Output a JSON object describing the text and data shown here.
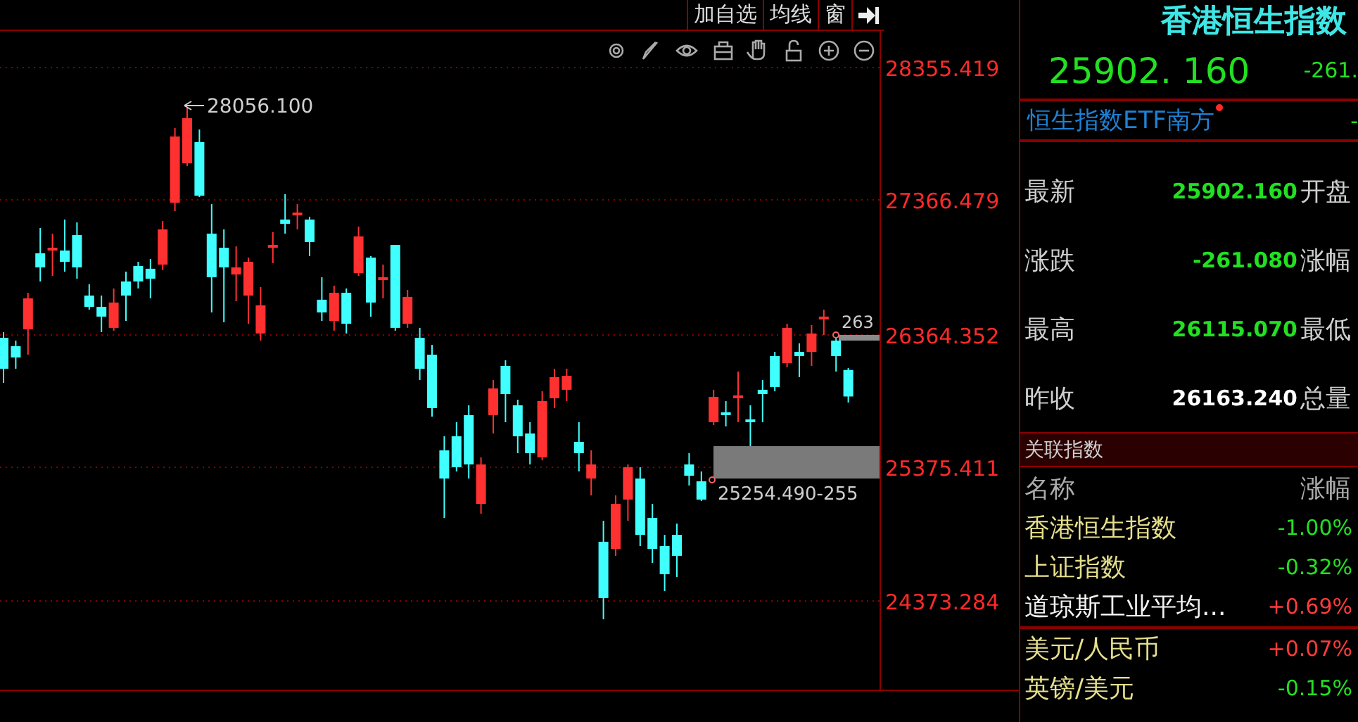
{
  "toolbar": {
    "buttons": [
      {
        "label": "加自选"
      },
      {
        "label": "均线"
      },
      {
        "label": "窗"
      }
    ]
  },
  "chart": {
    "peak_label": "28056.100",
    "range_label": "25254.490-255",
    "cut_label": "263",
    "chart_data": {
      "type": "candlestick",
      "categories": [
        null,
        null,
        null,
        null,
        null,
        null,
        null,
        null,
        null,
        null,
        null,
        null,
        null,
        null,
        null,
        null,
        null,
        null,
        null,
        null,
        null,
        null,
        null,
        null,
        null,
        null,
        null,
        null,
        null,
        null,
        null,
        null,
        null,
        null,
        null,
        null,
        null,
        null,
        null,
        null,
        null,
        null,
        null,
        null,
        null,
        null,
        null,
        null,
        null,
        null,
        null,
        null,
        null,
        null,
        null,
        null,
        null,
        null,
        null,
        null,
        null,
        null,
        null,
        null,
        null,
        null,
        null,
        null,
        null,
        null
      ],
      "grid": true,
      "ylim": [
        23715,
        28629
      ],
      "yticks": [
        {
          "value": 28355.419,
          "label": "28355.419"
        },
        {
          "value": 27366.479,
          "label": "27366.479"
        },
        {
          "value": 26364.352,
          "label": "26364.352"
        },
        {
          "value": 25375.411,
          "label": "25375.411"
        },
        {
          "value": 24373.284,
          "label": "24373.284"
        }
      ],
      "ohlc": [
        [
          26340,
          26382,
          26004,
          26109
        ],
        [
          26277,
          26319,
          26109,
          26193
        ],
        [
          26403,
          26676,
          26214,
          26634
        ],
        [
          26970,
          27159,
          26760,
          26865
        ],
        [
          26991,
          27117,
          26802,
          27012
        ],
        [
          26991,
          27222,
          26834,
          26907
        ],
        [
          27106,
          27201,
          26781,
          26865
        ],
        [
          26655,
          26739,
          26550,
          26571
        ],
        [
          26571,
          26655,
          26382,
          26498
        ],
        [
          26414,
          26708,
          26393,
          26603
        ],
        [
          26760,
          26834,
          26466,
          26655
        ],
        [
          26876,
          26907,
          26708,
          26760
        ],
        [
          26855,
          26928,
          26634,
          26781
        ],
        [
          26886,
          27212,
          26844,
          27149
        ],
        [
          27348,
          27905,
          27285,
          27842
        ],
        [
          27642,
          28056.1,
          27621,
          27978
        ],
        [
          27800,
          27894,
          27390,
          27400
        ],
        [
          27117,
          27337,
          26529,
          26792
        ],
        [
          27012,
          27149,
          26456,
          26865
        ],
        [
          26812,
          27022,
          26613,
          26865
        ],
        [
          26655,
          26938,
          26445,
          26907
        ],
        [
          26372,
          26718,
          26319,
          26582
        ],
        [
          27012,
          27128,
          26897,
          27033
        ],
        [
          27222,
          27411,
          27117,
          27190
        ],
        [
          27264,
          27337,
          27149,
          27274
        ],
        [
          27222,
          27243,
          26949,
          27054
        ],
        [
          26624,
          26792,
          26466,
          26529
        ],
        [
          26466,
          26729,
          26393,
          26676
        ],
        [
          26676,
          26708,
          26372,
          26445
        ],
        [
          26823,
          27170,
          26802,
          27096
        ],
        [
          26938,
          26949,
          26498,
          26603
        ],
        [
          26771,
          26886,
          26634,
          26792
        ],
        [
          27033,
          27033,
          26393,
          26414
        ],
        [
          26445,
          26697,
          26414,
          26645
        ],
        [
          26340,
          26414,
          26025,
          26109
        ],
        [
          26214,
          26288,
          25752,
          25815
        ],
        [
          25500,
          25605,
          24996,
          25290
        ],
        [
          25605,
          25710,
          25343,
          25374
        ],
        [
          25763,
          25836,
          25290,
          25395
        ],
        [
          25101,
          25448,
          25028,
          25395
        ],
        [
          25763,
          26025,
          25626,
          25962
        ],
        [
          26130,
          26172,
          25710,
          25920
        ],
        [
          25836,
          25878,
          25479,
          25605
        ],
        [
          25626,
          25710,
          25395,
          25479
        ],
        [
          25448,
          25941,
          25426,
          25868
        ],
        [
          25889,
          26109,
          25815,
          26046
        ],
        [
          25952,
          26109,
          25868,
          26056
        ],
        [
          25563,
          25710,
          25343,
          25479
        ],
        [
          25290,
          25500,
          25164,
          25395
        ],
        [
          24818,
          24975,
          24240,
          24398
        ],
        [
          24765,
          25164,
          24713,
          25101
        ],
        [
          25133,
          25395,
          24975,
          25374
        ],
        [
          25290,
          25374,
          24786,
          24870
        ],
        [
          24996,
          25101,
          24660,
          24765
        ],
        [
          24786,
          24870,
          24450,
          24576
        ],
        [
          24870,
          24954,
          24555,
          24713
        ],
        [
          25395,
          25479,
          25238,
          25311
        ],
        [
          25269,
          25343,
          25122,
          25133
        ],
        [
          25710,
          25952,
          25689,
          25899
        ],
        [
          25784,
          25868,
          25679,
          25763
        ],
        [
          25889,
          26088,
          25710,
          25910
        ],
        [
          25731,
          25836,
          25521,
          25710
        ],
        [
          25952,
          26025,
          25710,
          25920
        ],
        [
          26204,
          26235,
          25941,
          25973
        ],
        [
          26151,
          26445,
          26120,
          26414
        ],
        [
          26235,
          26298,
          26046,
          26204
        ],
        [
          26235,
          26435,
          26130,
          26372
        ],
        [
          26477,
          26550,
          26361,
          26498
        ],
        [
          26319,
          26361,
          26088,
          26204
        ],
        [
          26100,
          26115,
          25857,
          25902
        ]
      ]
    }
  },
  "quote": {
    "name": "香港恒生指数",
    "price": "25902. 160",
    "change": "-261."
  },
  "related_fund": {
    "name": "恒生指数ETF南方",
    "change": "-"
  },
  "stats": [
    {
      "label": "最新",
      "value": "25902.160",
      "color": "#22e022",
      "next_label": "开盘"
    },
    {
      "label": "涨跌",
      "value": "-261.080",
      "color": "#22e022",
      "next_label": "涨幅"
    },
    {
      "label": "最高",
      "value": "26115.070",
      "color": "#22e022",
      "next_label": "最低"
    },
    {
      "label": "昨收",
      "value": "26163.240",
      "color": "#ffffff",
      "next_label": "总量"
    }
  ],
  "related_indices": {
    "title": "关联指数",
    "columns": [
      "名称",
      "涨幅"
    ],
    "groups": [
      [
        {
          "name": "香港恒生指数",
          "change": "-1.00%",
          "color": "#22e022",
          "highlighted": true
        },
        {
          "name": "上证指数",
          "change": "-0.32%",
          "color": "#22e022",
          "highlighted": true
        },
        {
          "name": "道琼斯工业平均...",
          "change": "+0.69%",
          "color": "#ff3b3b",
          "highlighted": false
        }
      ],
      [
        {
          "name": "美元/人民币",
          "change": "+0.07%",
          "color": "#ff3b3b",
          "highlighted": true
        },
        {
          "name": "英镑/美元",
          "change": "-0.15%",
          "color": "#22e022",
          "highlighted": true
        }
      ]
    ]
  }
}
